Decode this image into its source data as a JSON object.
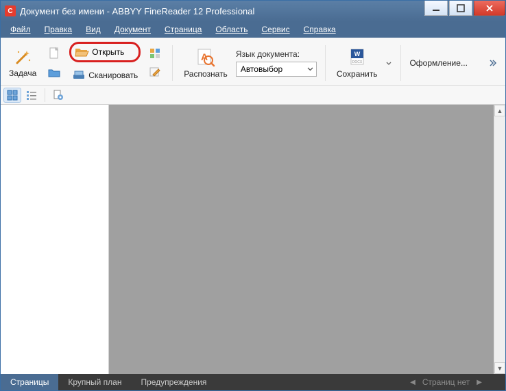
{
  "window": {
    "title": "Документ без имени - ABBYY FineReader 12 Professional",
    "app_icon_letter": "C"
  },
  "menu": {
    "items": [
      "Файл",
      "Правка",
      "Вид",
      "Документ",
      "Страница",
      "Область",
      "Сервис",
      "Справка"
    ]
  },
  "ribbon": {
    "task_label": "Задача",
    "open_label": "Открыть",
    "scan_label": "Сканировать",
    "recognize_label": "Распознать",
    "lang_label": "Язык документа:",
    "lang_value": "Автовыбор",
    "save_label": "Сохранить",
    "format_label": "Оформление..."
  },
  "bottom": {
    "tab_pages": "Страницы",
    "tab_zoom": "Крупный план",
    "tab_warnings": "Предупреждения",
    "pager_text": "Страниц нет"
  }
}
